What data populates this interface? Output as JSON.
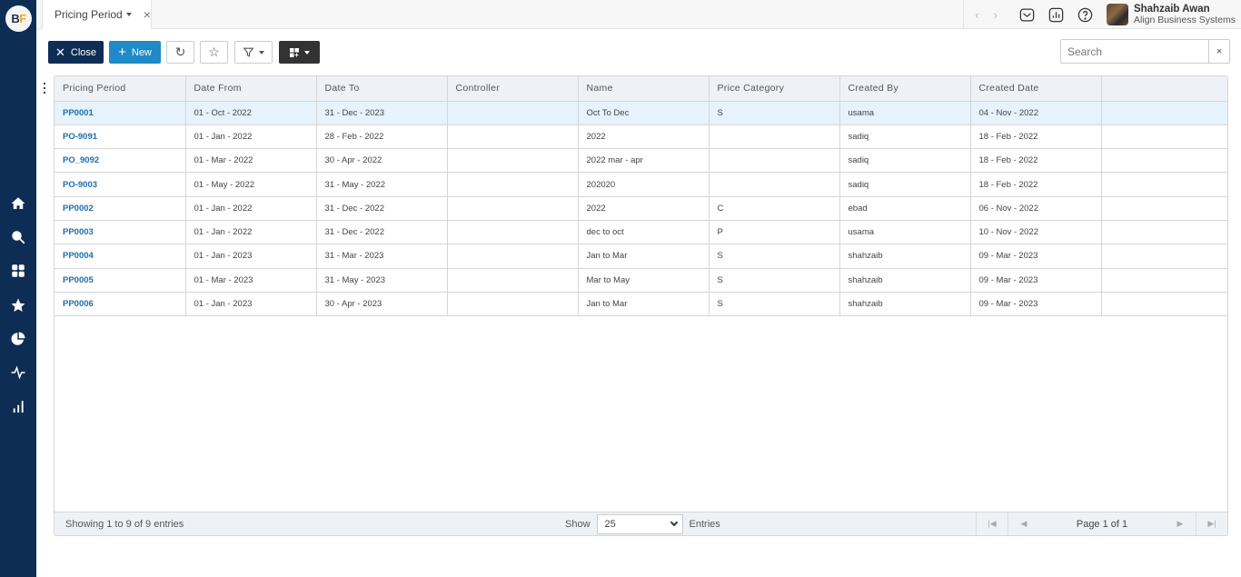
{
  "app": {
    "logo_b": "B",
    "logo_f": "F",
    "sidebar_icons": [
      "home-icon",
      "search-icon",
      "dashboard-icon",
      "star-icon",
      "pie-chart-icon",
      "activity-icon",
      "bar-chart-icon"
    ]
  },
  "topbar": {
    "tab_label": "Pricing Period",
    "tab_close": "×",
    "prev_arrow": "‹",
    "next_arrow": "›",
    "icons": [
      "mail-icon",
      "report-icon",
      "help-icon"
    ],
    "user": {
      "name": "Shahzaib Awan",
      "org": "Align Business Systems"
    }
  },
  "toolbar": {
    "close_label": "Close",
    "close_symbol": "✕",
    "new_label": "New",
    "new_symbol": "+",
    "refresh_symbol": "↻",
    "favorite_symbol": "☆"
  },
  "search": {
    "placeholder": "Search",
    "value": "",
    "clear": "×"
  },
  "grid": {
    "columns": [
      "Pricing Period",
      "Date From",
      "Date To",
      "Controller",
      "Name",
      "Price Category",
      "Created By",
      "Created Date",
      ""
    ],
    "rows": [
      [
        "PP0001",
        "01 - Oct - 2022",
        "31 - Dec - 2023",
        "",
        "Oct To Dec",
        "S",
        "usama",
        "04 - Nov - 2022",
        ""
      ],
      [
        "PO-9091",
        "01 - Jan - 2022",
        "28 - Feb - 2022",
        "",
        "2022",
        "",
        "sadiq",
        "18 - Feb - 2022",
        ""
      ],
      [
        "PO_9092",
        "01 - Mar - 2022",
        "30 - Apr - 2022",
        "",
        "2022 mar - apr",
        "",
        "sadiq",
        "18 - Feb - 2022",
        ""
      ],
      [
        "PO-9003",
        "01 - May - 2022",
        "31 - May - 2022",
        "",
        "202020",
        "",
        "sadiq",
        "18 - Feb - 2022",
        ""
      ],
      [
        "PP0002",
        "01 - Jan - 2022",
        "31 - Dec - 2022",
        "",
        "2022",
        "C",
        "ebad",
        "06 - Nov - 2022",
        ""
      ],
      [
        "PP0003",
        "01 - Jan - 2022",
        "31 - Dec - 2022",
        "",
        "dec to oct",
        "P",
        "usama",
        "10 - Nov - 2022",
        ""
      ],
      [
        "PP0004",
        "01 - Jan - 2023",
        "31 - Mar - 2023",
        "",
        "Jan to Mar",
        "S",
        "shahzaib",
        "09 - Mar - 2023",
        ""
      ],
      [
        "PP0005",
        "01 - Mar - 2023",
        "31 - May - 2023",
        "",
        "Mar to May",
        "S",
        "shahzaib",
        "09 - Mar - 2023",
        ""
      ],
      [
        "PP0006",
        "01 - Jan - 2023",
        "30 - Apr - 2023",
        "",
        "Jan to Mar",
        "S",
        "shahzaib",
        "09 - Mar - 2023",
        ""
      ]
    ],
    "selected_row": 0
  },
  "footer": {
    "showing": "Showing 1 to 9 of 9 entries",
    "show_label": "Show",
    "page_size": "25",
    "entries_label": "Entries",
    "page_label": "Page 1 of 1"
  }
}
